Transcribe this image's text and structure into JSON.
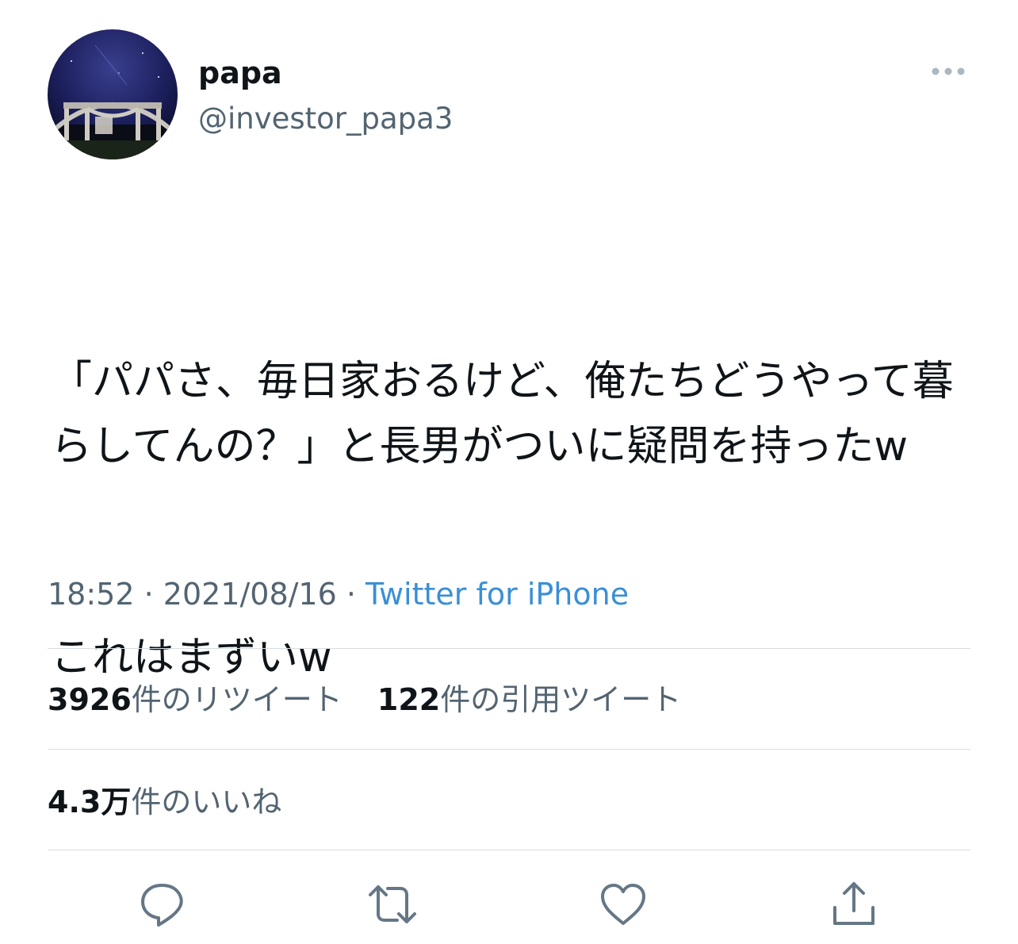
{
  "author": {
    "display_name": "papa",
    "handle": "@investor_papa3",
    "avatar_icon": "avatar-night-ruins-photo"
  },
  "tweet": {
    "paragraphs": [
      "「パパさ、毎日家おるけど、俺たちどうやって暮らしてんの？」と長男がついに疑問を持ったw",
      "これはまずいw"
    ],
    "time": "18:52",
    "separator": " · ",
    "date": "2021/08/16",
    "source": "Twitter for iPhone"
  },
  "stats": {
    "retweets_count": "3926",
    "retweets_label": "件のリツイート",
    "quotes_count": "122",
    "quotes_label": "件の引用ツイート",
    "likes_count": "4.3万",
    "likes_label": "件のいいね"
  },
  "actions": {
    "icons": [
      "reply-icon",
      "retweet-icon",
      "like-icon",
      "share-icon"
    ]
  },
  "colors": {
    "text": "#0f1419",
    "secondary": "#536471",
    "link": "#3b8fd6",
    "divider": "#d7dde2"
  }
}
